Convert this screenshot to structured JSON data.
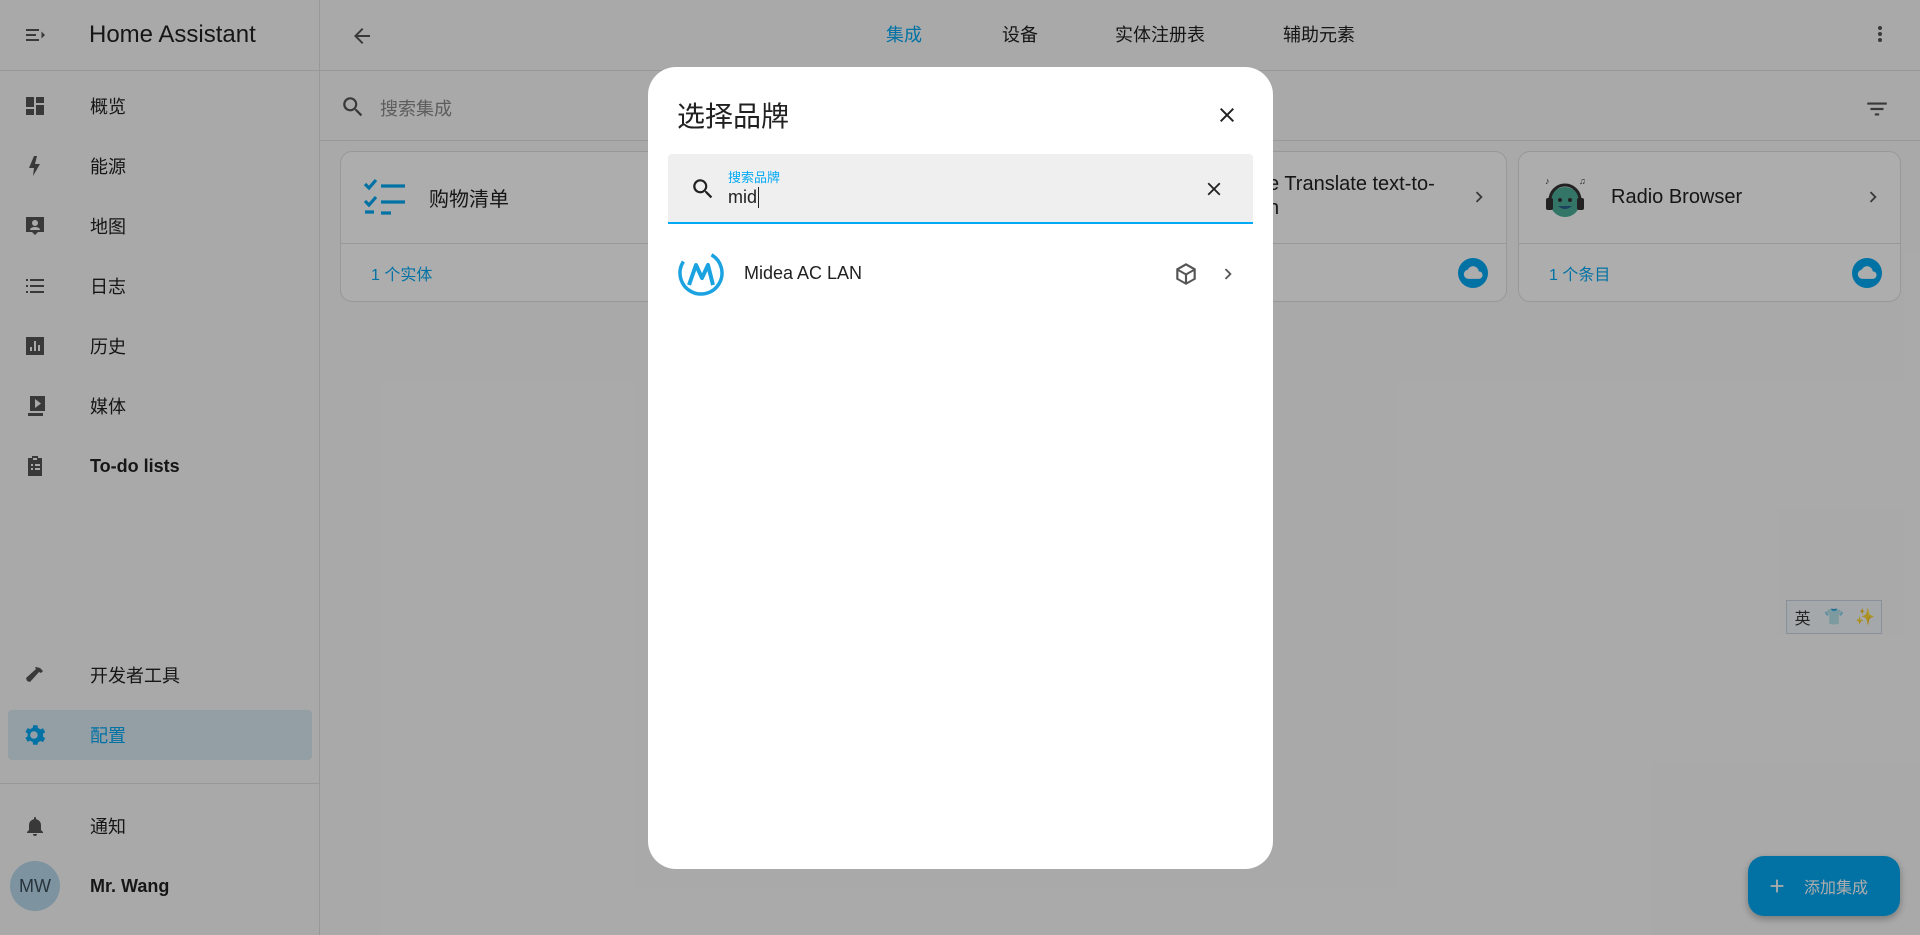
{
  "sidebar": {
    "title": "Home Assistant",
    "items": [
      {
        "label": "概览",
        "icon": "dashboard-icon"
      },
      {
        "label": "能源",
        "icon": "lightning-icon"
      },
      {
        "label": "地图",
        "icon": "map-account-icon"
      },
      {
        "label": "日志",
        "icon": "list-icon"
      },
      {
        "label": "历史",
        "icon": "chart-box-icon"
      },
      {
        "label": "媒体",
        "icon": "play-box-multiple-icon"
      },
      {
        "label": "To-do lists",
        "icon": "clipboard-list-icon"
      }
    ],
    "developer_tools": "开发者工具",
    "settings": "配置",
    "notifications": "通知",
    "user": {
      "initials": "MW",
      "name": "Mr. Wang"
    }
  },
  "topbar": {
    "tabs": [
      {
        "label": "集成",
        "active": true
      },
      {
        "label": "设备",
        "active": false
      },
      {
        "label": "实体注册表",
        "active": false
      },
      {
        "label": "辅助元素",
        "active": false
      }
    ]
  },
  "search": {
    "placeholder": "搜索集成"
  },
  "cards": [
    {
      "name": "购物清单",
      "footer": "1 个实体"
    },
    {
      "name": "e Translate text-to-\nn",
      "footer": ""
    },
    {
      "name": "Radio Browser",
      "footer": "1 个条目"
    }
  ],
  "ime": {
    "lang": "英"
  },
  "fab": {
    "label": "添加集成"
  },
  "dialog": {
    "title": "选择品牌",
    "search_label": "搜索品牌",
    "search_value": "mid",
    "results": [
      {
        "name": "Midea AC LAN",
        "icon": "custom-integration-cube-icon"
      }
    ]
  },
  "colors": {
    "accent": "#03a9f4",
    "active_bg": "#dbe9f3"
  }
}
